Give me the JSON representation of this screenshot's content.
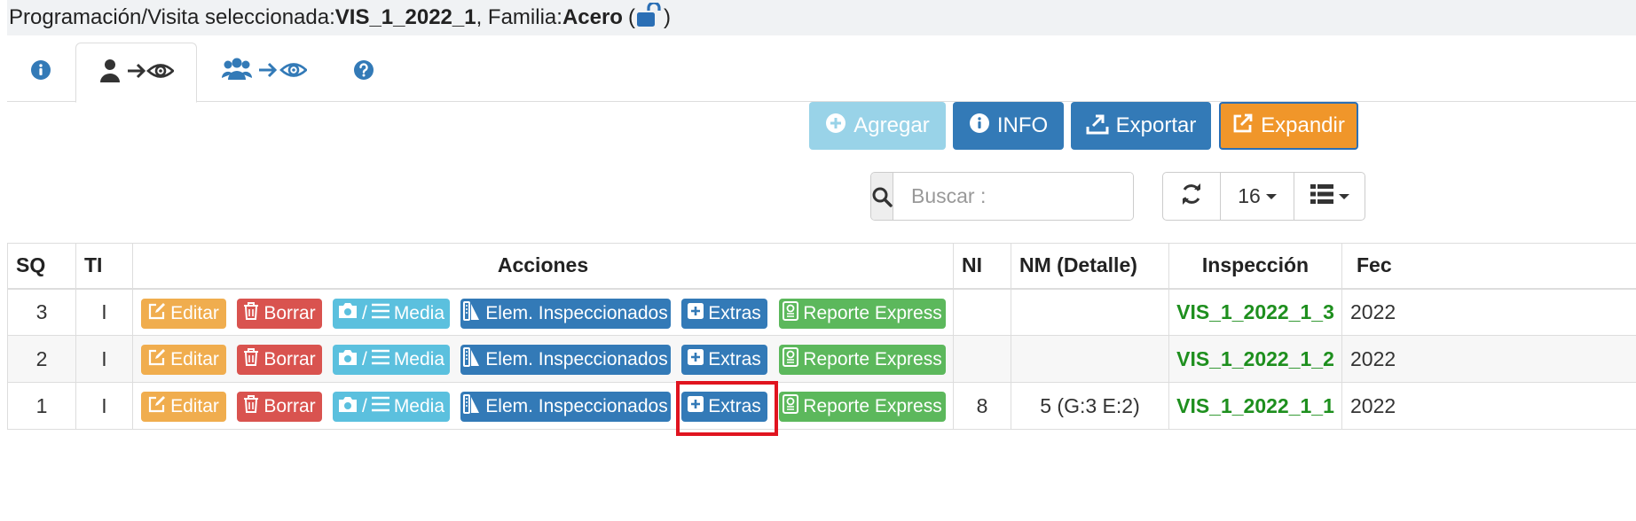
{
  "header": {
    "prefix": "Programación/Visita seleccionada: ",
    "visit": "VIS_1_2022_1",
    "family_label": ", Familia: ",
    "family": "Acero",
    "paren_open": "(",
    "paren_close": ")"
  },
  "tabs": [
    {
      "icon": "info-circle-icon"
    },
    {
      "icon": "user-arrow-eye-icon",
      "active": true
    },
    {
      "icon": "users-arrow-eye-icon"
    },
    {
      "icon": "question-circle-icon"
    }
  ],
  "toolbar": {
    "agregar": "Agregar",
    "info": "INFO",
    "exportar": "Exportar",
    "expandir": "Expandir"
  },
  "search": {
    "placeholder": "Buscar :"
  },
  "tools": {
    "page_size": "16"
  },
  "table": {
    "headers": [
      "SQ",
      "TI",
      "Acciones",
      "NI",
      "NM (Detalle)",
      "Inspección",
      "Fec"
    ],
    "actions": {
      "edit": "Editar",
      "delete": "Borrar",
      "media_sep": "/",
      "media": "Media",
      "elements": "Elem. Inspeccionados",
      "extras": "Extras",
      "report": "Reporte Express"
    },
    "rows": [
      {
        "sq": "3",
        "ti": "I",
        "ni": "",
        "nm": "",
        "inspeccion": "VIS_1_2022_1_3",
        "fecha": "2022"
      },
      {
        "sq": "2",
        "ti": "I",
        "ni": "",
        "nm": "",
        "inspeccion": "VIS_1_2022_1_2",
        "fecha": "2022"
      },
      {
        "sq": "1",
        "ti": "I",
        "ni": "8",
        "nm": "5 (G:3 E:2)",
        "inspeccion": "VIS_1_2022_1_1",
        "fecha": "2022"
      }
    ]
  },
  "colors": {
    "primary": "#337ab7",
    "warning": "#f0ad4e",
    "danger": "#d9534f",
    "info": "#5bc0de",
    "success": "#5cb85c",
    "highlight": "#e0141f"
  }
}
